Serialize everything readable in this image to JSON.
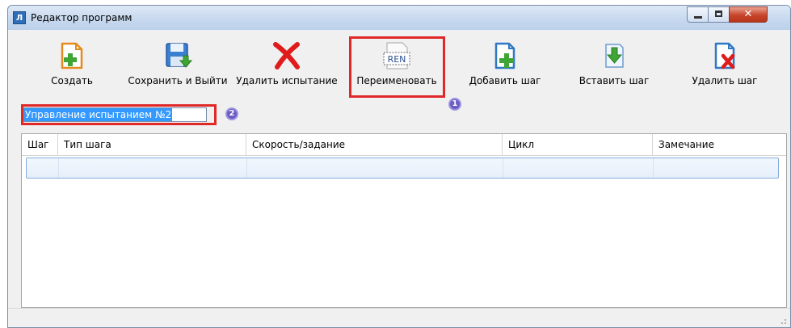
{
  "window": {
    "title": "Редактор программ",
    "app_icon_text": "Л",
    "close_glyph": "✕"
  },
  "toolbar": {
    "create_label": "Создать",
    "save_exit_label": "Сохранить и Выйти",
    "delete_test_label": "Удалить испытание",
    "rename_label": "Переименовать",
    "rename_icon_text": "REN",
    "add_step_label": "Добавить шаг",
    "insert_step_label": "Вставить шаг",
    "delete_step_label": "Удалить шаг"
  },
  "name_input": {
    "value": "Управление испытанием №2"
  },
  "annotations": {
    "badge1": "1",
    "badge2": "2",
    "highlight_color": "#e02828",
    "badge_color": "#6a5cc4"
  },
  "table": {
    "columns": [
      "Шаг",
      "Тип шага",
      "Скорость/задание",
      "Цикл",
      "Замечание"
    ],
    "rows": [
      [
        "",
        "",
        "",
        "",
        ""
      ]
    ]
  },
  "colors": {
    "selection": "#3399ff",
    "row_border": "#84acdd",
    "icon_green": "#3fa535",
    "icon_red": "#e01b1b"
  }
}
